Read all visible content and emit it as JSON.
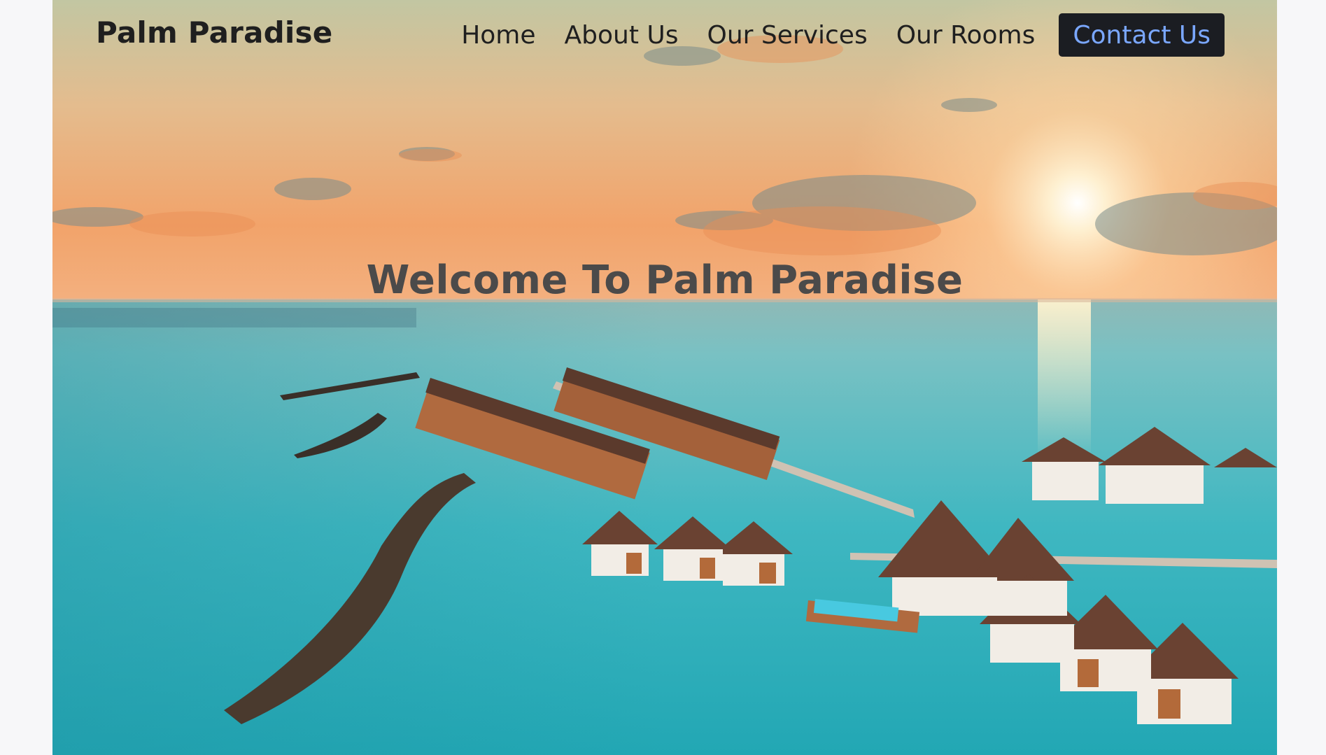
{
  "brand": {
    "name": "Palm Paradise"
  },
  "nav": {
    "links": [
      "Home",
      "About Us",
      "Our Services",
      "Our Rooms"
    ],
    "contact_label": "Contact Us"
  },
  "hero": {
    "title": "Welcome To Palm Paradise",
    "image": "overwater-villas-resort-sunset-photo"
  },
  "colors": {
    "page_bg": "#f7f7f9",
    "text_dark": "#1f1f1f",
    "button_bg": "#1b1d22",
    "button_text": "#7aa7ff",
    "hero_title": "#4b4a4a",
    "sea": "#2fb4bd",
    "sky_warm": "#f0a96c"
  }
}
